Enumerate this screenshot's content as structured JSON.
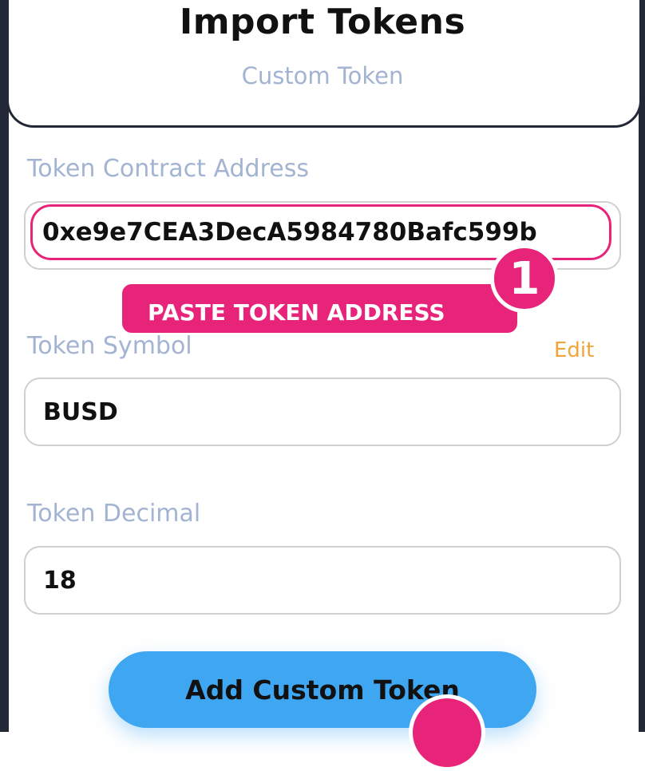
{
  "header": {
    "title": "Import Tokens",
    "subtitle": "Custom Token"
  },
  "form": {
    "contract_address": {
      "label": "Token Contract Address",
      "value": "0xe9e7CEA3DecA5984780Bafc599b"
    },
    "symbol": {
      "label": "Token Symbol",
      "edit_label": "Edit",
      "value": "BUSD"
    },
    "decimal": {
      "label": "Token Decimal",
      "value": "18"
    },
    "submit_label": "Add Custom Token"
  },
  "annotations": {
    "step1_number": "1",
    "step1_callout": "PASTE TOKEN ADDRESS"
  },
  "colors": {
    "accent": "#e8247a",
    "primary_button": "#3fa6f2",
    "label": "#a3b3d2",
    "edit": "#f0a43a",
    "frame": "#232836"
  }
}
